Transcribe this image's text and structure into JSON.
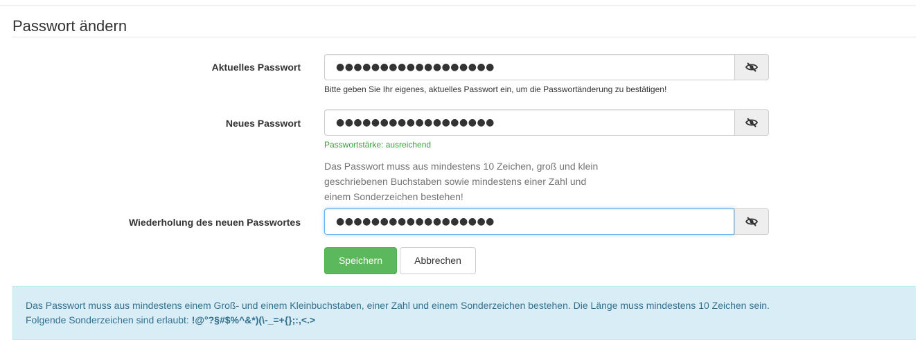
{
  "page": {
    "title": "Passwort ändern"
  },
  "fields": {
    "current": {
      "label": "Aktuelles Passwort",
      "value": "●●●●●●●●●●●●●●●●●●",
      "help": "Bitte geben Sie Ihr eigenes, aktuelles Passwort ein, um die Passwortänderung zu bestätigen!"
    },
    "new": {
      "label": "Neues Passwort",
      "value": "●●●●●●●●●●●●●●●●●●",
      "strength": "Passwortstärke: ausreichend",
      "info": "Das Passwort muss aus mindestens 10 Zeichen, groß und klein geschriebenen Buchstaben sowie mindestens einer Zahl und einem Sonderzeichen bestehen!"
    },
    "repeat": {
      "label": "Wiederholung des neuen Passwortes",
      "value": "●●●●●●●●●●●●●●●●●●"
    }
  },
  "icons": {
    "toggle_visibility": "eye-slash-icon"
  },
  "buttons": {
    "save": "Speichern",
    "cancel": "Abbrechen"
  },
  "alert": {
    "line1": "Das Passwort muss aus mindestens einem Groß- und einem Kleinbuchstaben, einer Zahl und einem Sonderzeichen bestehen. Die Länge muss mindestens 10 Zeichen sein.",
    "line2_prefix": "Folgende Sonderzeichen sind erlaubt: ",
    "allowed_chars": "!@°?§#$%^&*)(\\-_=+{};:,<.>"
  },
  "colors": {
    "save_button": "#5cb85c",
    "strength_text": "#3c9e3c",
    "alert_background": "#d9edf7",
    "alert_text": "#31708f",
    "focus_border": "#66afe9"
  }
}
